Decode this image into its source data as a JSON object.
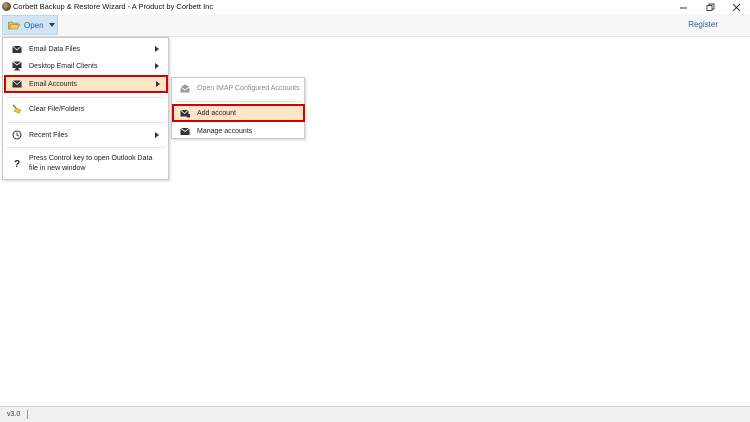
{
  "window": {
    "title": "Corbett Backup & Restore Wizard - A Product by Corbett Inc",
    "controls": [
      "minimize-icon",
      "restore-icon",
      "close-icon"
    ]
  },
  "toolbar": {
    "open_label": "Open",
    "register_label": "Register"
  },
  "open_menu": {
    "items": [
      {
        "label": "Email Data Files",
        "icon": "email-data-files-icon",
        "has_submenu": true
      },
      {
        "label": "Desktop Email Clients",
        "icon": "desktop-email-clients-icon",
        "has_submenu": true
      },
      {
        "label": "Email Accounts",
        "icon": "email-accounts-icon",
        "has_submenu": true,
        "highlighted": true
      },
      {
        "label": "Clear File/Folders",
        "icon": "broom-icon",
        "has_submenu": false
      },
      {
        "label": "Recent Files",
        "icon": "history-icon",
        "has_submenu": true
      },
      {
        "label": "Press Control key to open Outlook Data file in new window",
        "icon": "question-icon",
        "has_submenu": false
      }
    ]
  },
  "email_accounts_submenu": {
    "items": [
      {
        "label": "Open IMAP Configured Accounts",
        "icon": "imap-accounts-icon",
        "enabled": false
      },
      {
        "label": "Add account",
        "icon": "add-account-icon",
        "enabled": true,
        "highlighted": true
      },
      {
        "label": "Manage accounts",
        "icon": "manage-accounts-icon",
        "enabled": true
      }
    ]
  },
  "status": {
    "version": "v3.0"
  },
  "colors": {
    "accent": "#1f5f99",
    "open_button_bg": "#cfe4f5",
    "highlight_bg": "#fde5c8",
    "highlight_border": "#d40000"
  }
}
